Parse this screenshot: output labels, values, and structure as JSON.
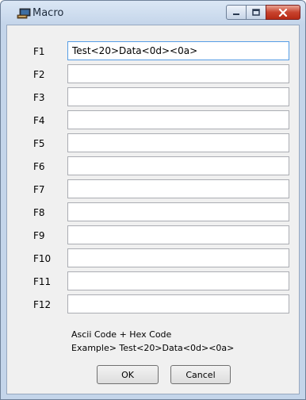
{
  "window": {
    "title": "Macro",
    "icons": {
      "app": "macro-app-icon",
      "minimize": "minimize-icon",
      "maximize": "maximize-icon",
      "close": "close-icon"
    }
  },
  "macros": [
    {
      "label": "F1",
      "value": "Test<20>Data<0d><0a>"
    },
    {
      "label": "F2",
      "value": ""
    },
    {
      "label": "F3",
      "value": ""
    },
    {
      "label": "F4",
      "value": ""
    },
    {
      "label": "F5",
      "value": ""
    },
    {
      "label": "F6",
      "value": ""
    },
    {
      "label": "F7",
      "value": ""
    },
    {
      "label": "F8",
      "value": ""
    },
    {
      "label": "F9",
      "value": ""
    },
    {
      "label": "F10",
      "value": ""
    },
    {
      "label": "F11",
      "value": ""
    },
    {
      "label": "F12",
      "value": ""
    }
  ],
  "hint": {
    "line1": "Ascii Code + Hex Code",
    "line2": "Example> Test<20>Data<0d><0a>"
  },
  "buttons": {
    "ok": "OK",
    "cancel": "Cancel"
  },
  "colors": {
    "close_button": "#c8432e",
    "titlebar": "#c4d5ea",
    "focus_border": "#569de5"
  }
}
